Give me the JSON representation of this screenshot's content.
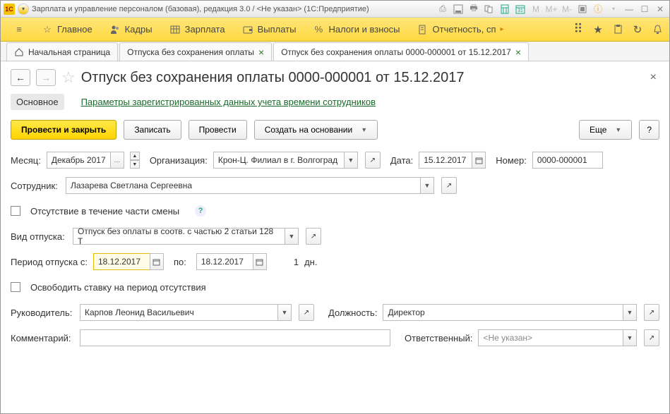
{
  "title": "Зарплата и управление персоналом (базовая), редакция 3.0 / <Не указан>  (1С:Предприятие)",
  "toolbar": {
    "items": [
      {
        "label": "Главное"
      },
      {
        "label": "Кадры"
      },
      {
        "label": "Зарплата"
      },
      {
        "label": "Выплаты"
      },
      {
        "label": "Налоги и взносы"
      },
      {
        "label": "Отчетность, сп"
      }
    ]
  },
  "tabs": [
    {
      "label": "Начальная страница",
      "home": true
    },
    {
      "label": "Отпуска без сохранения оплаты",
      "closeable": true
    },
    {
      "label": "Отпуск без сохранения оплаты 0000-000001 от 15.12.2017",
      "closeable": true,
      "active": true
    }
  ],
  "page_title": "Отпуск без сохранения оплаты 0000-000001 от 15.12.2017",
  "subtabs": {
    "main": "Основное",
    "link": "Параметры зарегистрированных данных учета времени сотрудников"
  },
  "buttons": {
    "primary": "Провести и закрыть",
    "save": "Записать",
    "post": "Провести",
    "createfrom": "Создать на основании",
    "more": "Еще",
    "help": "?"
  },
  "form": {
    "lbl_month": "Месяц:",
    "month": "Декабрь 2017",
    "lbl_org": "Организация:",
    "org": "Крон-Ц. Филиал в г. Волгоград",
    "lbl_date": "Дата:",
    "date": "15.12.2017",
    "lbl_num": "Номер:",
    "num": "0000-000001",
    "lbl_emp": "Сотрудник:",
    "emp": "Лазарева Светлана Сергеевна",
    "lbl_part": "Отсутствие в течение части смены",
    "lbl_type": "Вид отпуска:",
    "type": "Отпуск без оплаты в соотв. с частью 2 статьи 128 Т",
    "lbl_period": "Период отпуска с:",
    "from": "18.12.2017",
    "lbl_to": "по:",
    "to": "18.12.2017",
    "days": "1",
    "days_unit": "дн.",
    "lbl_free": "Освободить ставку на период отсутствия",
    "lbl_mgr": "Руководитель:",
    "mgr": "Карпов Леонид Васильевич",
    "lbl_pos": "Должность:",
    "pos": "Директор",
    "lbl_comment": "Комментарий:",
    "comment": "",
    "lbl_resp": "Ответственный:",
    "resp": "<Не указан>"
  }
}
